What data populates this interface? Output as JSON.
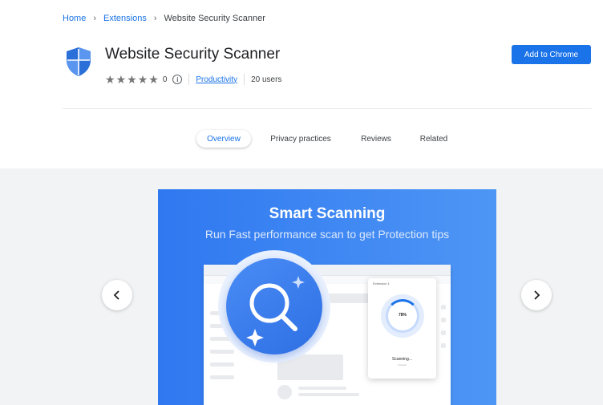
{
  "breadcrumb": {
    "home": "Home",
    "extensions": "Extensions",
    "current": "Website Security Scanner",
    "separator": "›"
  },
  "extension": {
    "title": "Website Security Scanner",
    "rating_stars": 0,
    "rating_count": "0",
    "category": "Productivity",
    "users": "20 users",
    "icon": "shield-icon",
    "accent_color": "#1a73e8"
  },
  "actions": {
    "add_label": "Add to Chrome"
  },
  "tabs": [
    {
      "label": "Overview",
      "active": true
    },
    {
      "label": "Privacy practices",
      "active": false
    },
    {
      "label": "Reviews",
      "active": false
    },
    {
      "label": "Related",
      "active": false
    }
  ],
  "slide": {
    "title": "Smart Scanning",
    "subtitle": "Run Fast performance scan to get Protection tips",
    "popup_header": "Extension 1",
    "progress_value": "78%",
    "scanning_label": "Scanning...",
    "scanning_sub": "4 issues"
  },
  "gallery": {
    "prev_icon": "chevron-left-icon",
    "next_icon": "chevron-right-icon"
  }
}
